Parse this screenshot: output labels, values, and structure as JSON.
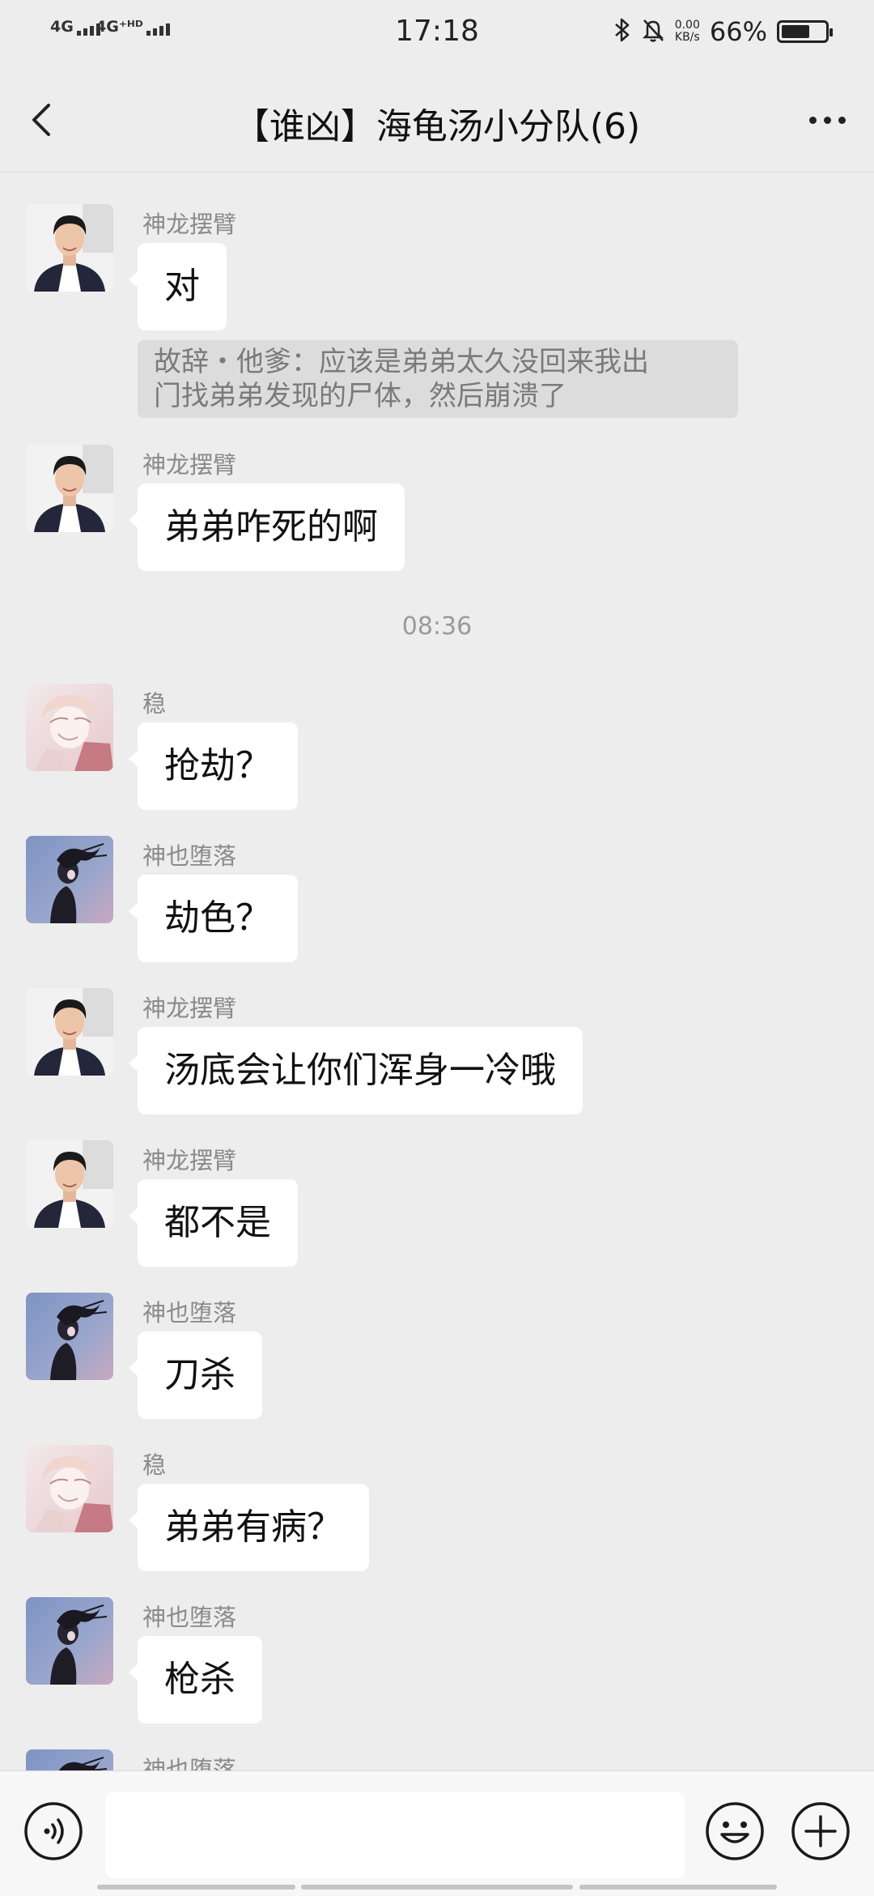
{
  "status": {
    "net1": "4G",
    "net2": "4G⁺ᴴᴰ",
    "time": "17:18",
    "speed_value": "0.00",
    "speed_unit": "KB/s",
    "battery_pct": "66%",
    "battery_level": 0.66,
    "icons": [
      "bluetooth-icon",
      "silent-icon"
    ]
  },
  "header": {
    "title": "【谁凶】海龟汤小分队(6)",
    "back_icon": "chevron-left-icon",
    "more_icon": "more-dots-icon"
  },
  "messages": [
    {
      "sender": "神龙摆臂",
      "text": "对",
      "avatar": "avatar-man"
    },
    {
      "sender": "神龙摆臂",
      "text": "弟弟咋死的啊",
      "avatar": "avatar-man"
    },
    {
      "sender": "稳",
      "text": "抢劫？",
      "avatar": "avatar-anime-pink"
    },
    {
      "sender": "神也堕落",
      "text": "劫色？",
      "avatar": "avatar-anime-dark"
    },
    {
      "sender": "神龙摆臂",
      "text": "汤底会让你们浑身一冷哦",
      "avatar": "avatar-man"
    },
    {
      "sender": "神龙摆臂",
      "text": "都不是",
      "avatar": "avatar-man"
    },
    {
      "sender": "神也堕落",
      "text": "刀杀",
      "avatar": "avatar-anime-dark"
    },
    {
      "sender": "稳",
      "text": "弟弟有病？",
      "avatar": "avatar-anime-pink"
    },
    {
      "sender": "神也堕落",
      "text": "枪杀",
      "avatar": "avatar-anime-dark"
    },
    {
      "sender": "神也堕落",
      "text": "",
      "avatar": "avatar-anime-dark"
    }
  ],
  "quote": {
    "line1": "故辞・他爹：应该是弟弟太久没回来我出",
    "line2": "门找弟弟发现的尸体，然后崩溃了"
  },
  "timestamp": "08:36",
  "bottom": {
    "voice_icon": "voice-icon",
    "emoji_icon": "emoji-icon",
    "plus_icon": "plus-icon",
    "input_value": ""
  }
}
